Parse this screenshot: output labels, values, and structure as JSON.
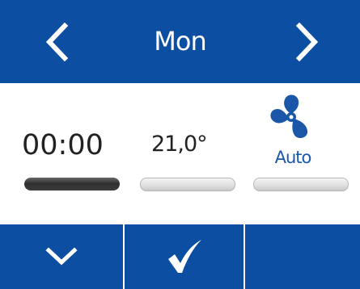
{
  "header": {
    "day": "Mon",
    "prev_icon": "chevron-left-icon",
    "next_icon": "chevron-right-icon"
  },
  "schedule": {
    "time": "00:00",
    "temperature": "21,0°",
    "fan_mode": "Auto",
    "fan_icon": "fan-icon"
  },
  "footer": {
    "down_icon": "chevron-down-icon",
    "confirm_icon": "check-icon"
  },
  "colors": {
    "primary_blue": "#0b4ea2",
    "fan_blue": "#1a57a8",
    "background": "#ffffff",
    "selected_bar": "#3b3b3b",
    "idle_bar": "#e2e2e2"
  }
}
